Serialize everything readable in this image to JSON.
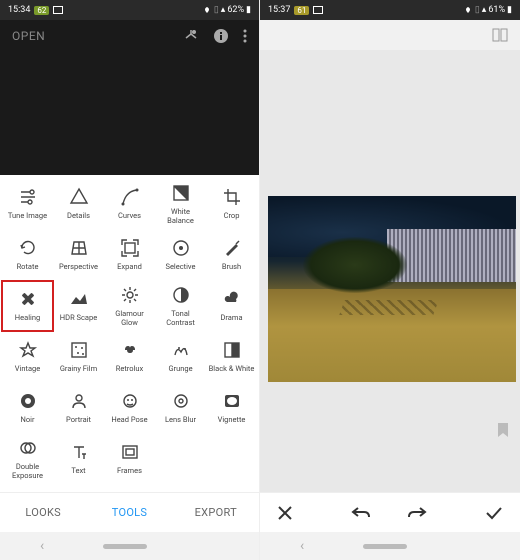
{
  "left": {
    "status": {
      "time": "15:34",
      "badge": "62",
      "battery": "62%"
    },
    "top_label": "OPEN",
    "tabs": {
      "looks": "LOOKS",
      "tools": "TOOLS",
      "export": "EXPORT"
    },
    "tools": [
      {
        "name": "tune-image",
        "label": "Tune Image",
        "icon": "tune",
        "highlighted": false
      },
      {
        "name": "details",
        "label": "Details",
        "icon": "details",
        "highlighted": false
      },
      {
        "name": "curves",
        "label": "Curves",
        "icon": "curves",
        "highlighted": false
      },
      {
        "name": "white-balance",
        "label": "White Balance",
        "icon": "wb",
        "highlighted": false
      },
      {
        "name": "crop",
        "label": "Crop",
        "icon": "crop",
        "highlighted": false
      },
      {
        "name": "rotate",
        "label": "Rotate",
        "icon": "rotate",
        "highlighted": false
      },
      {
        "name": "perspective",
        "label": "Perspective",
        "icon": "perspective",
        "highlighted": false
      },
      {
        "name": "expand",
        "label": "Expand",
        "icon": "expand",
        "highlighted": false
      },
      {
        "name": "selective",
        "label": "Selective",
        "icon": "selective",
        "highlighted": false
      },
      {
        "name": "brush",
        "label": "Brush",
        "icon": "brush",
        "highlighted": false
      },
      {
        "name": "healing",
        "label": "Healing",
        "icon": "healing",
        "highlighted": true
      },
      {
        "name": "hdr-scape",
        "label": "HDR Scape",
        "icon": "hdr",
        "highlighted": false
      },
      {
        "name": "glamour-glow",
        "label": "Glamour Glow",
        "icon": "glow",
        "highlighted": false
      },
      {
        "name": "tonal-contrast",
        "label": "Tonal Contrast",
        "icon": "tonal",
        "highlighted": false
      },
      {
        "name": "drama",
        "label": "Drama",
        "icon": "drama",
        "highlighted": false
      },
      {
        "name": "vintage",
        "label": "Vintage",
        "icon": "vintage",
        "highlighted": false
      },
      {
        "name": "grainy-film",
        "label": "Grainy Film",
        "icon": "grainy",
        "highlighted": false
      },
      {
        "name": "retrolux",
        "label": "Retrolux",
        "icon": "retrolux",
        "highlighted": false
      },
      {
        "name": "grunge",
        "label": "Grunge",
        "icon": "grunge",
        "highlighted": false
      },
      {
        "name": "black-white",
        "label": "Black & White",
        "icon": "bw",
        "highlighted": false
      },
      {
        "name": "noir",
        "label": "Noir",
        "icon": "noir",
        "highlighted": false
      },
      {
        "name": "portrait",
        "label": "Portrait",
        "icon": "portrait",
        "highlighted": false
      },
      {
        "name": "head-pose",
        "label": "Head Pose",
        "icon": "headpose",
        "highlighted": false
      },
      {
        "name": "lens-blur",
        "label": "Lens Blur",
        "icon": "lensblur",
        "highlighted": false
      },
      {
        "name": "vignette",
        "label": "Vignette",
        "icon": "vignette",
        "highlighted": false
      },
      {
        "name": "double-exposure",
        "label": "Double Exposure",
        "icon": "double",
        "highlighted": false
      },
      {
        "name": "text",
        "label": "Text",
        "icon": "text",
        "highlighted": false
      },
      {
        "name": "frames",
        "label": "Frames",
        "icon": "frames",
        "highlighted": false
      }
    ]
  },
  "right": {
    "status": {
      "time": "15:37",
      "badge": "61",
      "battery": "61%"
    }
  }
}
